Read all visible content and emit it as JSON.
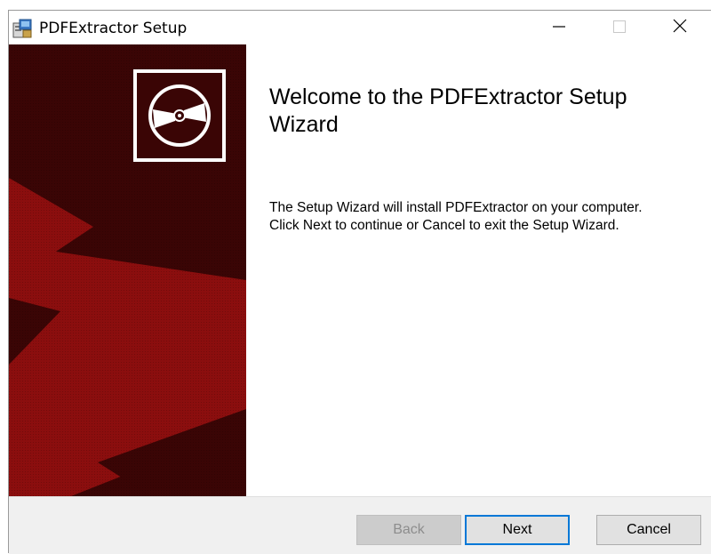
{
  "window": {
    "title": "PDFExtractor Setup",
    "controls": {
      "minimize_icon": "minimize-icon",
      "maximize_icon": "maximize-icon",
      "close_icon": "close-icon"
    }
  },
  "banner": {
    "colors": {
      "dark": "#3a0505",
      "light": "#8b0e0e"
    },
    "icon": "cd-icon"
  },
  "main": {
    "heading": "Welcome to the PDFExtractor Setup Wizard",
    "description_lines": [
      "The Setup Wizard will install PDFExtractor on your computer.",
      "Click Next to continue or Cancel to exit the Setup Wizard."
    ]
  },
  "footer": {
    "back_label": "Back",
    "back_enabled": false,
    "next_label": "Next",
    "cancel_label": "Cancel"
  },
  "colors": {
    "accent": "#0078d7",
    "footer_bg": "#f0f0f0"
  }
}
